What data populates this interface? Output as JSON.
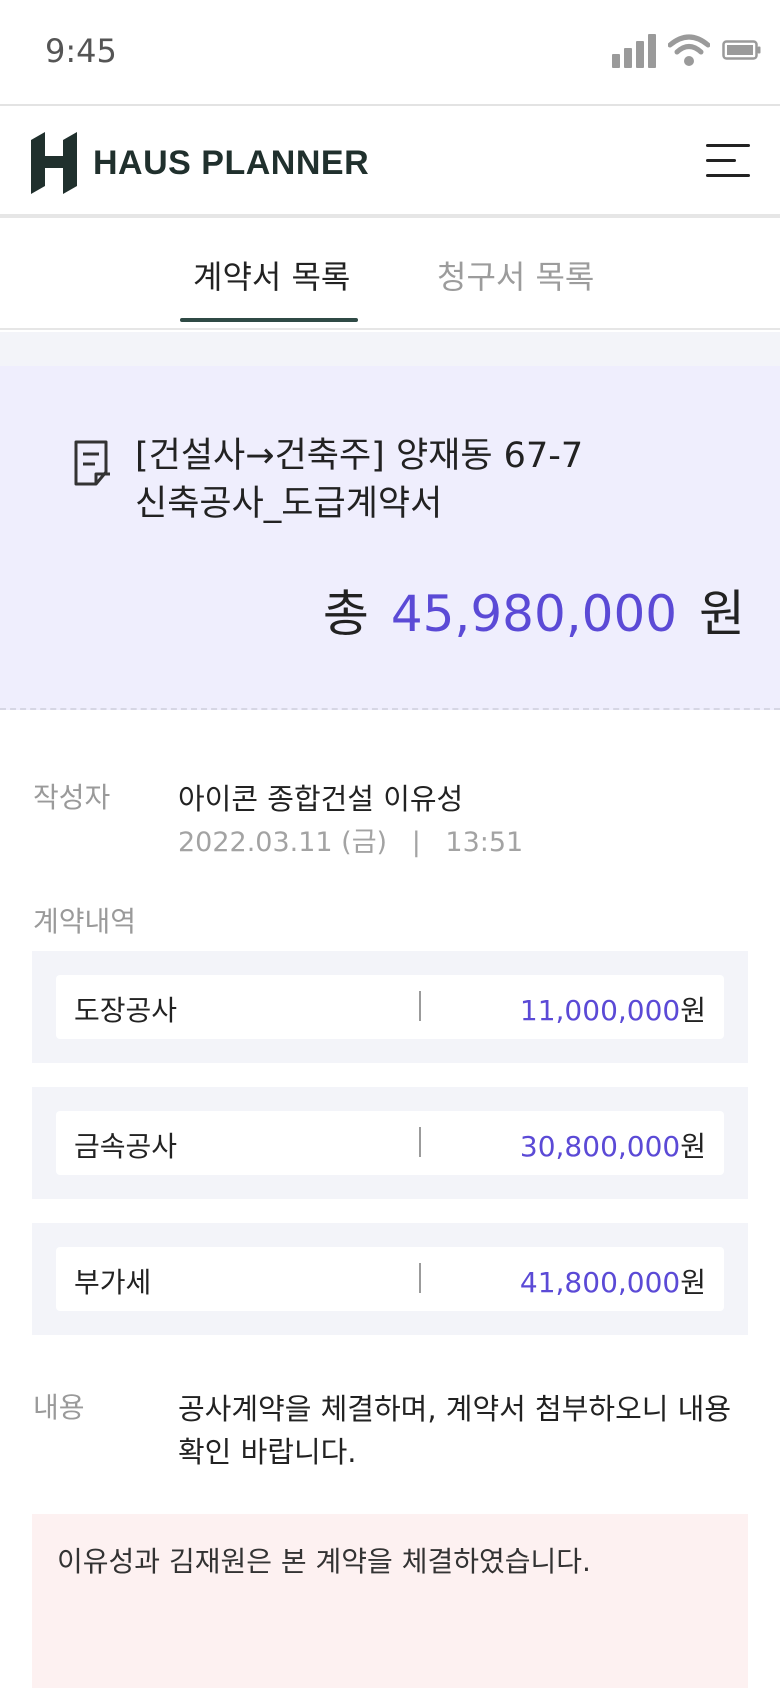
{
  "status_bar": {
    "time": "9:45"
  },
  "header": {
    "logo_text": "HAUS PLANNER"
  },
  "tabs": [
    {
      "label": "계약서 목록",
      "active": true
    },
    {
      "label": "청구서 목록",
      "active": false
    }
  ],
  "contract": {
    "title_line1": "[건설사→건축주] 양재동 67-7",
    "title_line2": "신축공사_도급계약서",
    "total_prefix": "총",
    "total_amount": "45,980,000",
    "total_unit": "원"
  },
  "details": {
    "author_label": "작성자",
    "author_value": "아이콘 종합건설 이유성",
    "date": "2022.03.11 (금)",
    "date_separator": "|",
    "time": "13:51",
    "items_label": "계약내역",
    "items": [
      {
        "name": "도장공사",
        "amount": "11,000,000",
        "unit": "원"
      },
      {
        "name": "금속공사",
        "amount": "30,800,000",
        "unit": "원"
      },
      {
        "name": "부가세",
        "amount": "41,800,000",
        "unit": "원"
      }
    ],
    "content_label": "내용",
    "content_line1": "공사계약을 체결하며, 계약서 첨부하오니 내용",
    "content_line2": "확인 바랍니다.",
    "notice": "이유성과 김재원은 본 계약을 체결하였습니다."
  },
  "colors": {
    "accent": "#5b4ad6",
    "brand": "#20302d",
    "summary_bg": "#efeefd",
    "notice_bg": "#fdf1f1"
  }
}
